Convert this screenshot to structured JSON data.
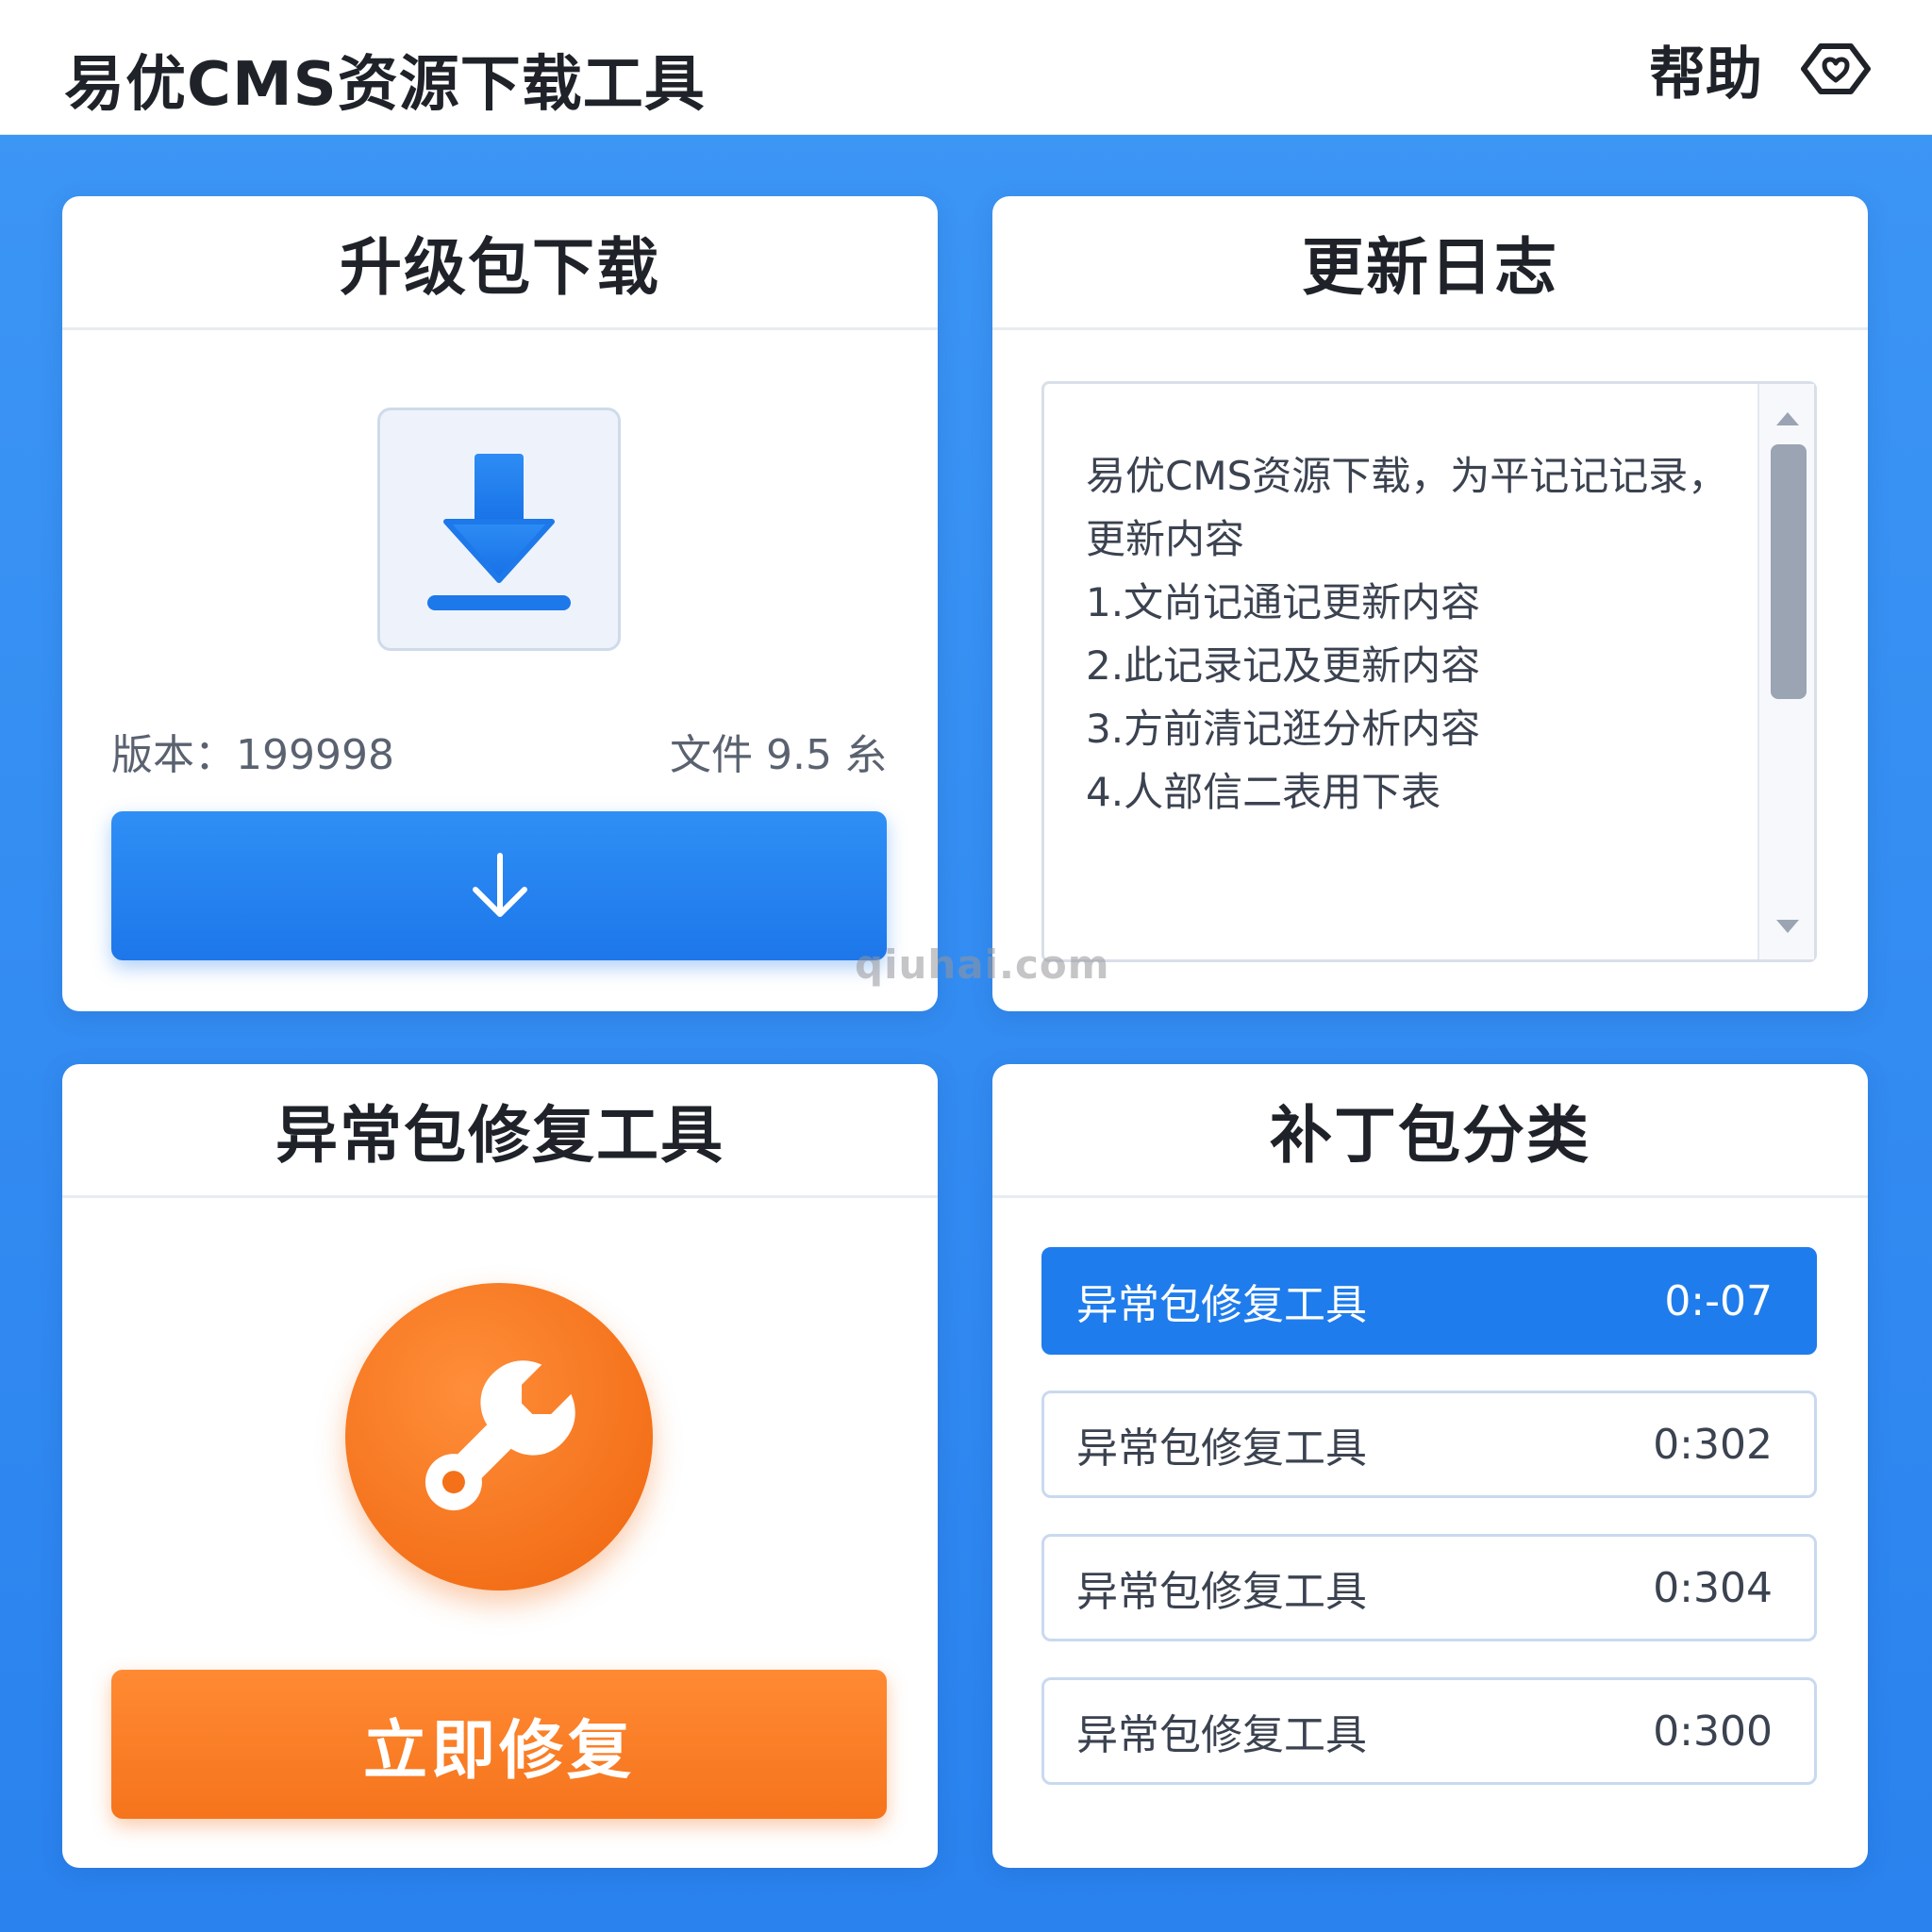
{
  "app": {
    "title": "易优CMS资源下载工具",
    "help_label": "帮助",
    "help_icon": "help-heart-icon"
  },
  "upgrade": {
    "title": "升级包下载",
    "tile_icon": "download-icon",
    "version_text": "版本：199998",
    "size_text": "文件 9.5 糸",
    "button_icon": "arrow-down-icon"
  },
  "changelog": {
    "title": "更新日志",
    "lines": [
      "易优CMS资源下载，为平记记记录，",
      "更新内容",
      "1.文尚记通记更新内容",
      "2.此记录记及更新内容",
      "3.方前清记逛分析内容",
      "4.人部信二表用下表"
    ]
  },
  "repair": {
    "title": "异常包修复工具",
    "icon": "wrench-icon",
    "button_label": "立即修复"
  },
  "patches": {
    "title": "补丁包分类",
    "items": [
      {
        "name": "异常包修复工具",
        "time": "0:-07",
        "active": true
      },
      {
        "name": "异常包修复工具",
        "time": "0:302",
        "active": false
      },
      {
        "name": "异常包修复工具",
        "time": "0:304",
        "active": false
      },
      {
        "name": "异常包修复工具",
        "time": "0:300",
        "active": false
      }
    ]
  },
  "watermark": "qiuhai.com",
  "colors": {
    "background": "#2f8af0",
    "primary": "#1f7cec",
    "accent_orange": "#f5741c"
  }
}
